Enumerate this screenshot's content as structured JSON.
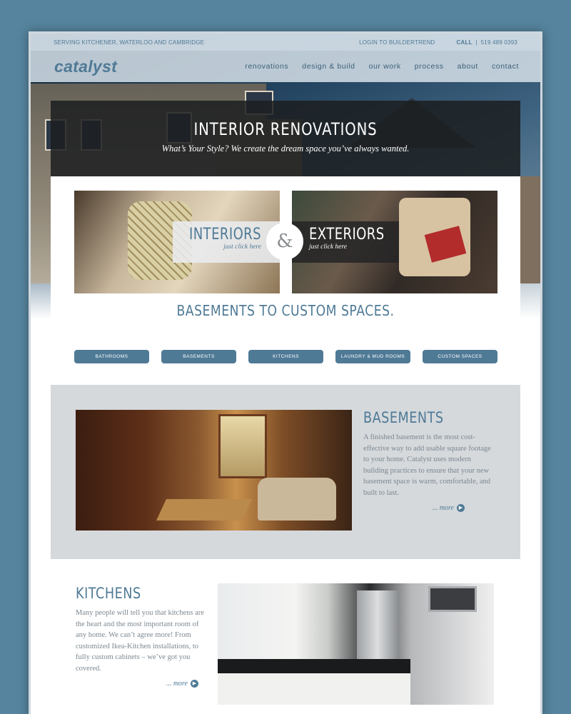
{
  "topbar": {
    "serving": "SERVING KITCHENER, WATERLOO AND CAMBRIDGE",
    "login": "LOGIN TO BUILDERTREND",
    "call_label": "CALL",
    "phone": "519 489 0393"
  },
  "brand": {
    "logo": "catalyst"
  },
  "nav": {
    "items": [
      "renovations",
      "design & build",
      "our work",
      "process",
      "about",
      "contact"
    ]
  },
  "hero": {
    "title": "INTERIOR RENOVATIONS",
    "subtitle": "What’s Your Style? We create the dream space you’ve always wanted."
  },
  "tiles": {
    "interiors": {
      "label": "INTERIORS",
      "link": "just click here"
    },
    "amp": "&",
    "exteriors": {
      "label": "EXTERIORS",
      "link": "just click here"
    }
  },
  "tagline": "BASEMENTS TO CUSTOM SPACES.",
  "categories": [
    "BATHROOMS",
    "BASEMENTS",
    "KITCHENS",
    "LAUNDRY & MUD ROOMS",
    "CUSTOM SPACES"
  ],
  "basements": {
    "title": "BASEMENTS",
    "text": "A finished basement is the most cost-effective way to add usable square footage to your home. Catalyst uses modern building practices to ensure that your new basement space is warm, comfortable, and built to last.",
    "more": "... more"
  },
  "kitchens": {
    "title": "KITCHENS",
    "text": "Many people will tell you that kitchens are the heart and the most important room of any home. We can’t agree more! From customized Ikea-Kitchen installations, to fully custom cabinets – we’ve got you covered.",
    "more": "... more"
  },
  "colors": {
    "accent": "#4f7a96",
    "background": "#56849e",
    "panel": "#d5d9dc"
  },
  "icons": {
    "more": "chevron-right-icon"
  }
}
